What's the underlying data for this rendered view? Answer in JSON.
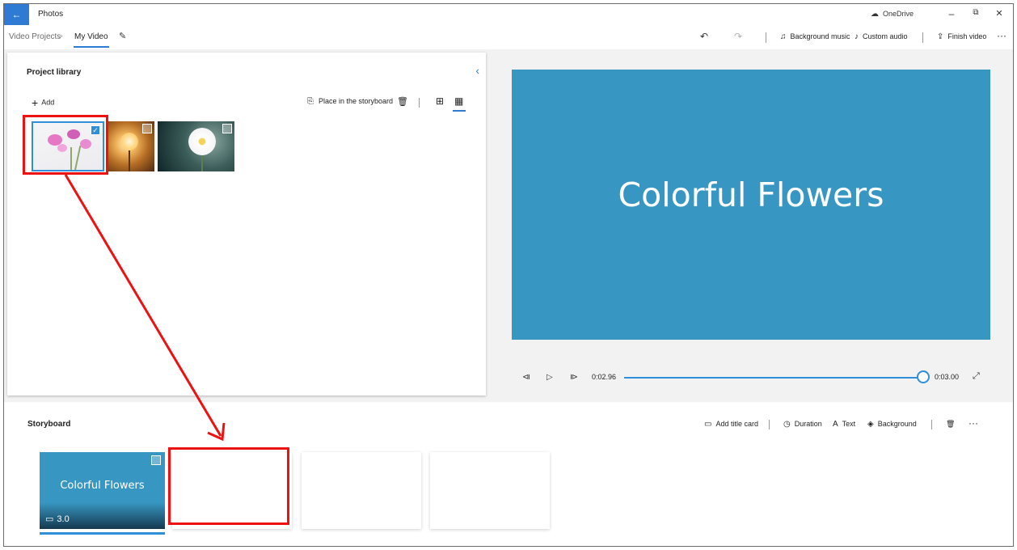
{
  "window": {
    "app_title": "Photos",
    "onedrive_label": "OneDrive",
    "controls": {
      "minimize": "–",
      "restore": "⧉",
      "close": "✕"
    }
  },
  "breadcrumb": {
    "parent": "Video Projects",
    "separator": ">",
    "current": "My Video"
  },
  "toolbar": {
    "background_music": "Background music",
    "custom_audio": "Custom audio",
    "finish_video": "Finish video",
    "more": "···"
  },
  "library": {
    "title": "Project library",
    "add_label": "Add",
    "place_label": "Place in the storyboard",
    "items": [
      {
        "name": "Pink cosmos flowers",
        "selected": true
      },
      {
        "name": "Dandelion at sunset",
        "selected": false
      },
      {
        "name": "White daisy",
        "selected": false
      }
    ]
  },
  "preview": {
    "title_text": "Colorful Flowers",
    "current_time": "0:02.96",
    "total_time": "0:03.00",
    "progress": 0.987
  },
  "storyboard": {
    "title": "Storyboard",
    "add_title_card": "Add title card",
    "duration": "Duration",
    "text": "Text",
    "background": "Background",
    "more": "···",
    "cards": [
      {
        "type": "title-card",
        "text": "Colorful Flowers",
        "duration": "3.0"
      },
      {
        "type": "empty"
      },
      {
        "type": "empty"
      },
      {
        "type": "empty"
      }
    ]
  },
  "colors": {
    "accent": "#2f8fd8",
    "title_card_bg": "#3897c2",
    "annotation": "#ee1111"
  }
}
